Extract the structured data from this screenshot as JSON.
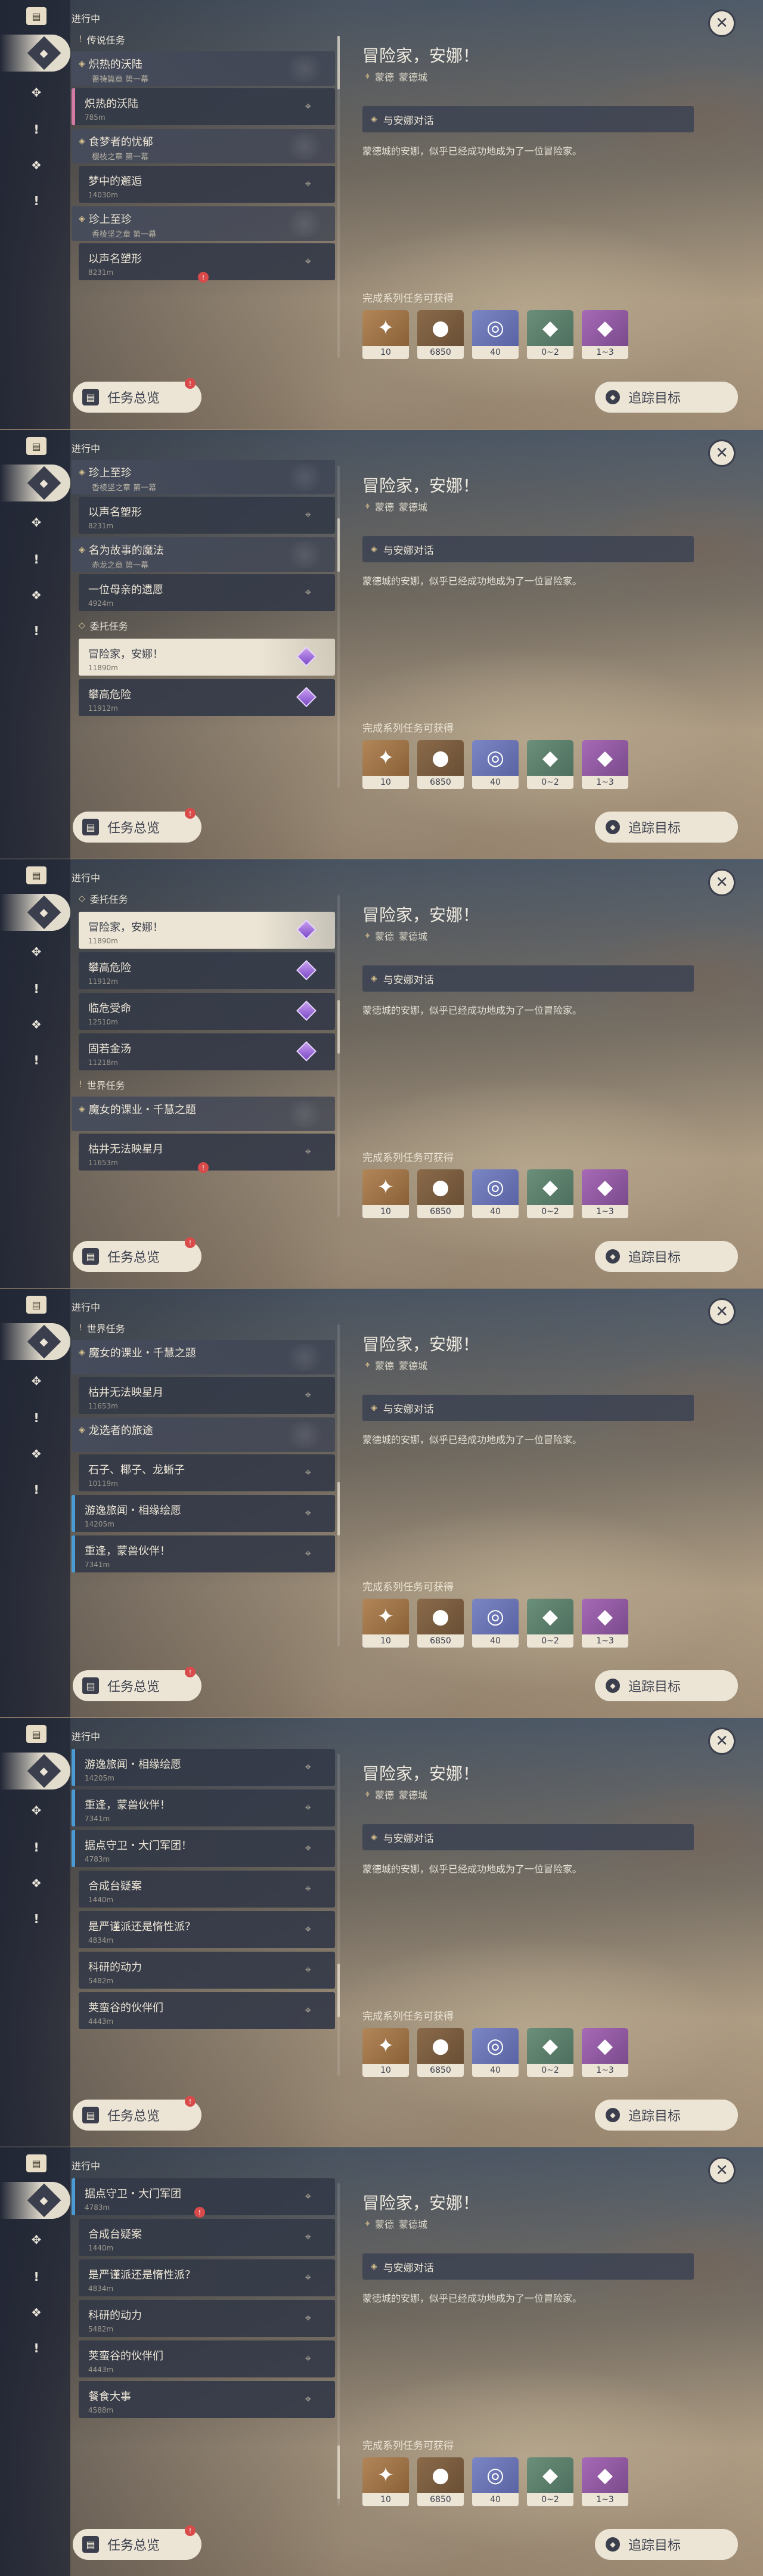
{
  "header": {
    "in_progress": "进行中"
  },
  "rail": {
    "book_icon": "book-icon",
    "icons": [
      "diamond-icon",
      "compass-icon",
      "exclamation-icon",
      "lattice-icon",
      "exclamation-icon"
    ]
  },
  "footer": {
    "overview": "任务总览",
    "overview_badge": "!",
    "track": "追踪目标"
  },
  "detail": {
    "title": "冒险家，安娜！",
    "location": [
      "蒙德",
      "蒙德城"
    ],
    "step": "与安娜对话",
    "description": "蒙德城的安娜，似乎已经成功地成为了一位冒险家。",
    "reward_label": "完成系列任务可获得",
    "rewards": [
      {
        "name": "primogem",
        "amount": "10",
        "symbol": "✦"
      },
      {
        "name": "mora",
        "amount": "6850",
        "symbol": "●"
      },
      {
        "name": "adventure-exp",
        "amount": "40",
        "symbol": "◎"
      },
      {
        "name": "crystal-green",
        "amount": "0~2",
        "symbol": "◆"
      },
      {
        "name": "crystal-purple",
        "amount": "1~3",
        "symbol": "◆"
      }
    ]
  },
  "frames": [
    {
      "scroll": 0,
      "rail_active": 0,
      "items": [
        {
          "kind": "section",
          "icon": "!",
          "label": "传说任务"
        },
        {
          "kind": "chapter",
          "title": "炽热的沃陆",
          "sub": "蔷祷篇章 第一幕"
        },
        {
          "kind": "quest",
          "name": "炽热的沃陆",
          "dist": "785m",
          "variant": "barpink",
          "right": "pin"
        },
        {
          "kind": "chapter",
          "title": "食梦者的忧郁",
          "sub": "樱枝之章 第一幕"
        },
        {
          "kind": "quest",
          "name": "梦中的邂逅",
          "dist": "14030m",
          "right": "pin"
        },
        {
          "kind": "chapter",
          "title": "珍上至珍",
          "sub": "香棱坚之章 第一幕"
        },
        {
          "kind": "quest",
          "name": "以声名塑形",
          "dist": "8231m",
          "right": "pin",
          "badge": "!"
        }
      ]
    },
    {
      "scroll": 1,
      "rail_active": 0,
      "items": [
        {
          "kind": "chapter",
          "title": "珍上至珍",
          "sub": "香棱坚之章 第一幕"
        },
        {
          "kind": "quest",
          "name": "以声名塑形",
          "dist": "8231m",
          "right": "pin"
        },
        {
          "kind": "chapter",
          "title": "名为故事的魔法",
          "sub": "赤龙之章 第一幕"
        },
        {
          "kind": "quest",
          "name": "一位母亲的遗愿",
          "dist": "4924m",
          "right": "pin"
        },
        {
          "kind": "section",
          "icon": "◇",
          "label": "委托任务"
        },
        {
          "kind": "quest",
          "name": "冒险家，安娜！",
          "dist": "11890m",
          "variant": "selected",
          "right": "gem"
        },
        {
          "kind": "quest",
          "name": "攀高危险",
          "dist": "11912m",
          "right": "gem"
        }
      ]
    },
    {
      "scroll": 2,
      "rail_active": 0,
      "items": [
        {
          "kind": "section",
          "icon": "◇",
          "label": "委托任务"
        },
        {
          "kind": "quest",
          "name": "冒险家，安娜！",
          "dist": "11890m",
          "variant": "selected",
          "right": "gem"
        },
        {
          "kind": "quest",
          "name": "攀高危险",
          "dist": "11912m",
          "right": "gem"
        },
        {
          "kind": "quest",
          "name": "临危受命",
          "dist": "12510m",
          "right": "gem"
        },
        {
          "kind": "quest",
          "name": "固若金汤",
          "dist": "11218m",
          "right": "gem"
        },
        {
          "kind": "section",
          "icon": "!",
          "label": "世界任务"
        },
        {
          "kind": "chapter",
          "title": "魔女的课业・千慧之题",
          "sub": ""
        },
        {
          "kind": "quest",
          "name": "枯井无法映星月",
          "dist": "11653m",
          "right": "pin",
          "badge": "!"
        }
      ]
    },
    {
      "scroll": 3,
      "rail_active": 0,
      "items": [
        {
          "kind": "section",
          "icon": "!",
          "label": "世界任务"
        },
        {
          "kind": "chapter",
          "title": "魔女的课业・千慧之题",
          "sub": ""
        },
        {
          "kind": "quest",
          "name": "枯井无法映星月",
          "dist": "11653m",
          "right": "pin"
        },
        {
          "kind": "chapter",
          "title": "龙选者的旅途",
          "sub": ""
        },
        {
          "kind": "quest",
          "name": "石子、椰子、龙蜥子",
          "dist": "10119m",
          "right": "pin"
        },
        {
          "kind": "quest",
          "name": "游逸旅闻・相缘绘愿",
          "dist": "14205m",
          "variant": "bar",
          "right": "pin"
        },
        {
          "kind": "quest",
          "name": "重逢，蒙兽伙伴！",
          "dist": "7341m",
          "variant": "bar",
          "right": "pin"
        }
      ]
    },
    {
      "scroll": 4,
      "rail_active": 0,
      "items": [
        {
          "kind": "quest",
          "name": "游逸旅闻・相缘绘愿",
          "dist": "14205m",
          "variant": "bar",
          "right": "pin"
        },
        {
          "kind": "quest",
          "name": "重逢，蒙兽伙伴！",
          "dist": "7341m",
          "variant": "bar",
          "right": "pin"
        },
        {
          "kind": "quest",
          "name": "据点守卫・大门军团！",
          "dist": "4783m",
          "variant": "bar",
          "right": "pin"
        },
        {
          "kind": "quest",
          "name": "合成台疑案",
          "dist": "1440m",
          "right": "pin"
        },
        {
          "kind": "quest",
          "name": "是严谨派还是惰性派？",
          "dist": "4834m",
          "right": "pin"
        },
        {
          "kind": "quest",
          "name": "科研的动力",
          "dist": "5482m",
          "right": "pin"
        },
        {
          "kind": "quest",
          "name": "荚蛮谷的伙伴们",
          "dist": "4443m",
          "right": "pin"
        }
      ]
    },
    {
      "scroll": 5,
      "rail_active": 0,
      "items": [
        {
          "kind": "quest",
          "name": "据点守卫・大门军团",
          "dist": "4783m",
          "variant": "bar",
          "right": "pin",
          "badge": "!"
        },
        {
          "kind": "quest",
          "name": "合成台疑案",
          "dist": "1440m",
          "right": "pin"
        },
        {
          "kind": "quest",
          "name": "是严谨派还是惰性派？",
          "dist": "4834m",
          "right": "pin"
        },
        {
          "kind": "quest",
          "name": "科研的动力",
          "dist": "5482m",
          "right": "pin"
        },
        {
          "kind": "quest",
          "name": "荚蛮谷的伙伴们",
          "dist": "4443m",
          "right": "pin"
        },
        {
          "kind": "quest",
          "name": "餐食大事",
          "dist": "4588m",
          "right": "pin"
        }
      ]
    }
  ]
}
